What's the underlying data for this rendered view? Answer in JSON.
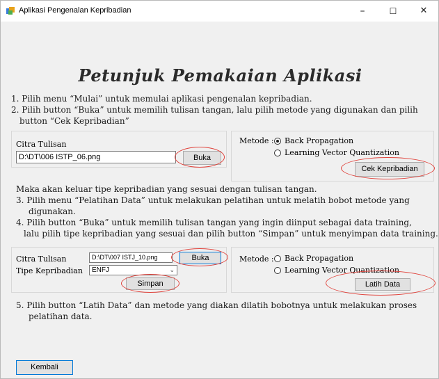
{
  "window": {
    "title": "Aplikasi Pengenalan Kepribadian",
    "minimize": "–",
    "maximize": "☐",
    "close": "✕"
  },
  "heading": "Petunjuk Pemakaian Aplikasi",
  "instructions_top": {
    "step1": "1. Pilih menu “Mulai” untuk memulai aplikasi pengenalan kepribadian.",
    "step2_line1": "2. Pilih button “Buka” untuk memilih tulisan tangan, lalu pilih metode yang digunakan  dan pilih",
    "step2_line2": "button “Cek Kepribadian”"
  },
  "panel1": {
    "citra_label": "Citra Tulisan",
    "citra_path": "D:\\DT\\006 ISTP_06.png",
    "buka_button": "Buka",
    "metode_label": "Metode :",
    "option_bp": "Back Propagation",
    "option_lvq": "Learning Vector Quantization",
    "selected": "Back Propagation",
    "cek_button": "Cek Kepribadian"
  },
  "instructions_mid": {
    "intro": "Maka akan keluar tipe kepribadian yang sesuai dengan tulisan tangan.",
    "step3_line1": "3. Pilih menu “Pelatihan Data” untuk melakukan pelatihan untuk melatih bobot metode  yang",
    "step3_line2": "digunakan.",
    "step4_line1": "4. Pilih button “Buka” untuk memilih tulisan tangan yang ingin diinput sebagai data training,",
    "step4_line2": "lalu pilih tipe kepribadian yang sesuai dan pilih button “Simpan” untuk menyimpan data training."
  },
  "panel2": {
    "citra_label": "Citra Tulisan",
    "citra_path": "D:\\DT\\007 ISTJ_10.png",
    "buka_button": "Buka",
    "tipe_label": "Tipe Kepribadian",
    "tipe_value": "ENFJ",
    "simpan_button": "Simpan",
    "metode_label": "Metode :",
    "option_bp": "Back Propagation",
    "option_lvq": "Learning Vector Quantization",
    "latih_button": "Latih Data"
  },
  "instructions_bottom": {
    "step5_line1": "5. Pilih button “Latih Data” dan metode yang diakan dilatih bobotnya untuk melakukan proses",
    "step5_line2": "pelatihan data."
  },
  "kembali_button": "Kembali",
  "colors": {
    "annotation_red": "#e0433c",
    "focus_blue": "#0078d7"
  }
}
